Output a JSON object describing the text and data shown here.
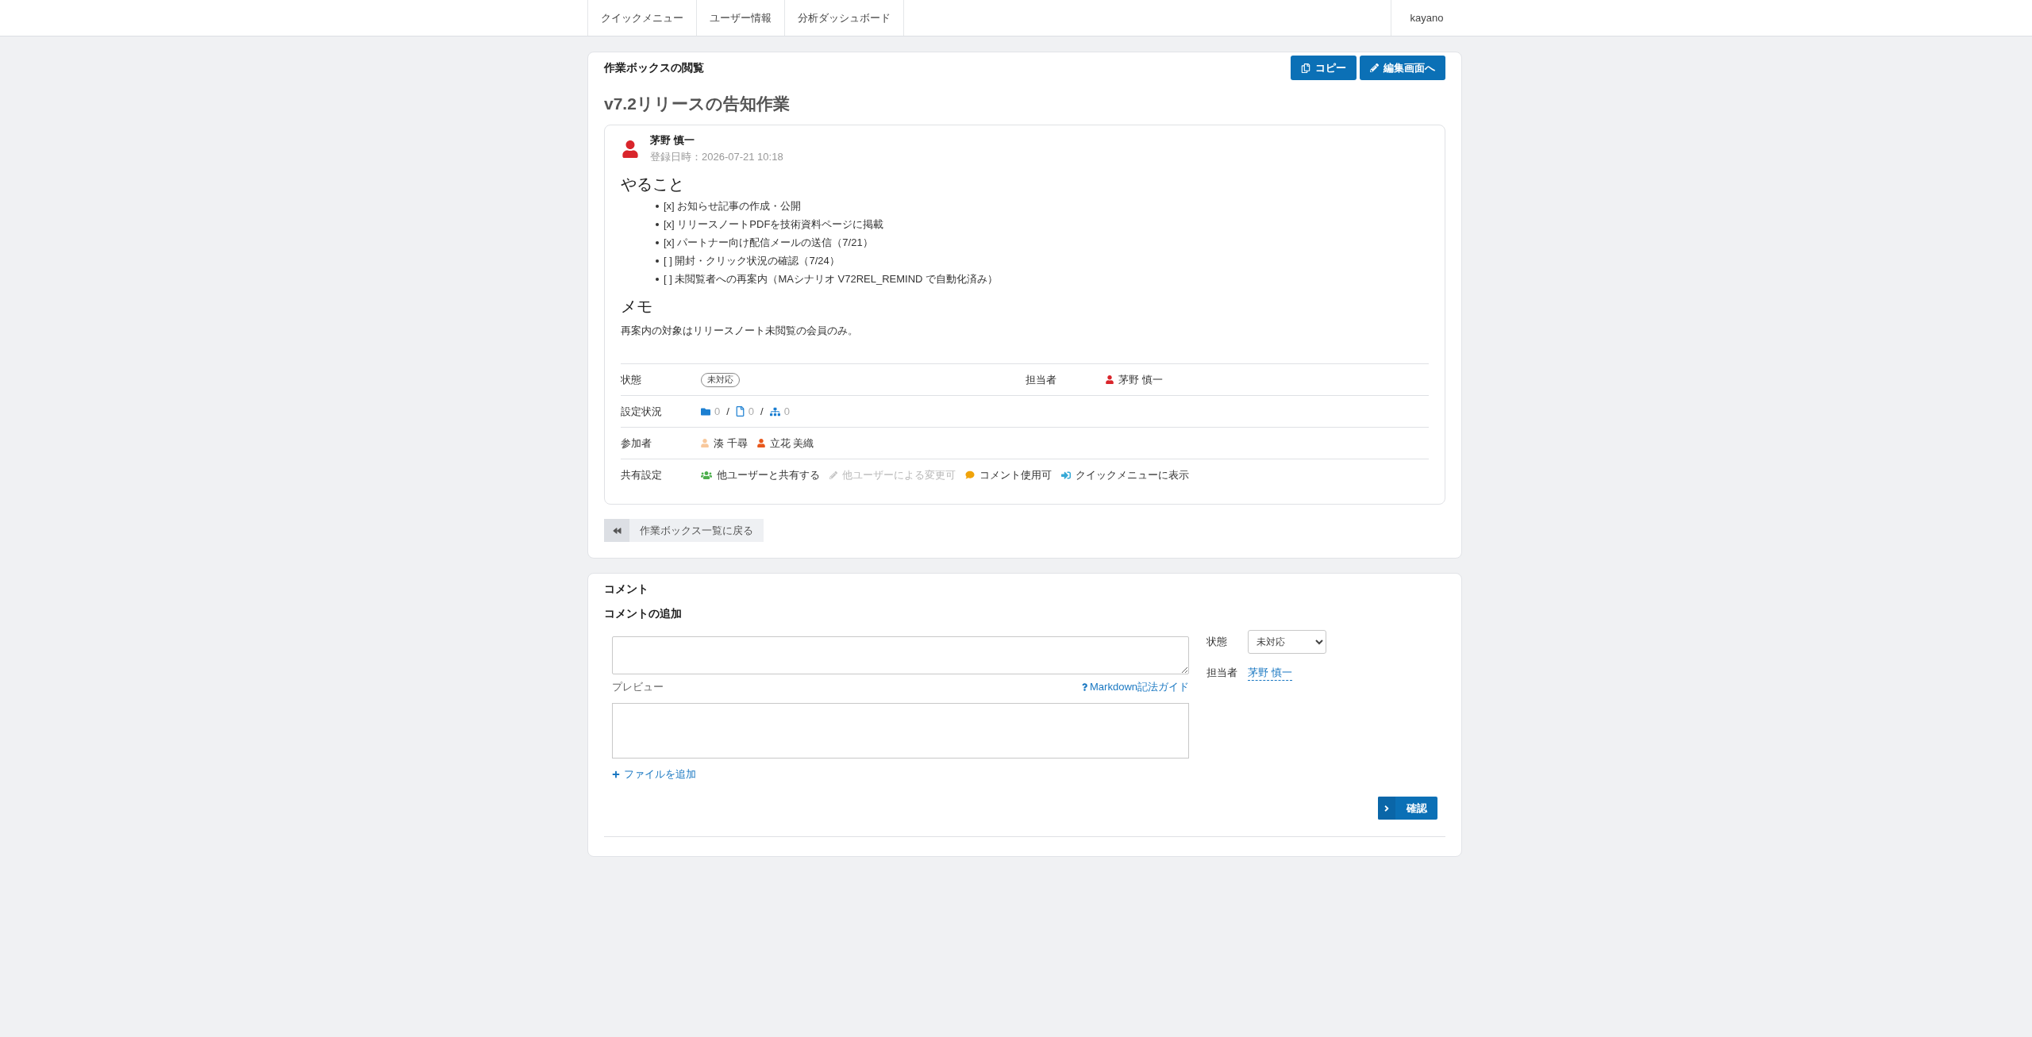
{
  "nav": {
    "items": [
      {
        "label": "クイックメニュー"
      },
      {
        "label": "ユーザー情報"
      },
      {
        "label": "分析ダッシュボード"
      }
    ],
    "user": "kayano"
  },
  "box": {
    "header": "作業ボックスの閲覧",
    "actions": [
      {
        "kind": "copy",
        "label": "コピー"
      },
      {
        "kind": "edit",
        "label": "編集画面へ"
      }
    ],
    "title": "v7.2リリースの告知作業",
    "post": {
      "author": "茅野 慎一",
      "registered": "登録日時：2026-07-21 10:18",
      "sections": [
        {
          "kind": "heading",
          "text": "やること"
        },
        {
          "kind": "list",
          "items": [
            "[x] お知らせ記事の作成・公開",
            "[x] リリースノートPDFを技術資料ページに掲載",
            "[x] パートナー向け配信メールの送信（7/21）",
            "[ ] 開封・クリック状況の確認（7/24）",
            "[ ] 未閲覧者への再案内（MAシナリオ V72REL_REMIND で自動化済み）"
          ]
        },
        {
          "kind": "heading",
          "text": "メモ"
        },
        {
          "kind": "paragraph",
          "text": "再案内の対象はリリースノート未閲覧の会員のみ。"
        }
      ]
    },
    "details": {
      "status": {
        "label": "状態",
        "value": "未対応"
      },
      "assignee": {
        "label": "担当者",
        "name": "茅野 慎一"
      },
      "settings": {
        "label": "設定状況",
        "items": [
          {
            "kind": "folder",
            "count": "0",
            "separator": "/"
          },
          {
            "kind": "file",
            "count": "0",
            "separator": "/"
          },
          {
            "kind": "hierarchy",
            "count": "0"
          }
        ]
      },
      "participants": {
        "label": "参加者",
        "people": [
          {
            "name": "湊 千尋",
            "color": "#f8c89c"
          },
          {
            "name": "立花 美織",
            "color": "#e8581c"
          }
        ]
      },
      "sharing": {
        "label": "共有設定",
        "options": [
          {
            "kind": "share",
            "label": "他ユーザーと共有する",
            "enabled": true
          },
          {
            "kind": "edit",
            "label": "他ユーザーによる変更可",
            "enabled": false
          },
          {
            "kind": "comment",
            "label": "コメント使用可",
            "enabled": true
          },
          {
            "kind": "quick-menu",
            "label": "クイックメニューに表示",
            "enabled": true
          }
        ]
      }
    },
    "back": {
      "label": "作業ボックス一覧に戻る"
    }
  },
  "comments": {
    "title": "コメント",
    "subtitle": "コメントの追加",
    "preview_label": "プレビュー",
    "guide_link": "Markdown記法ガイド",
    "add_file": "ファイルを追加",
    "status": {
      "label": "状態",
      "value": "未対応"
    },
    "assignee": {
      "label": "担当者",
      "name": "茅野 慎一"
    },
    "submit": "確認"
  }
}
